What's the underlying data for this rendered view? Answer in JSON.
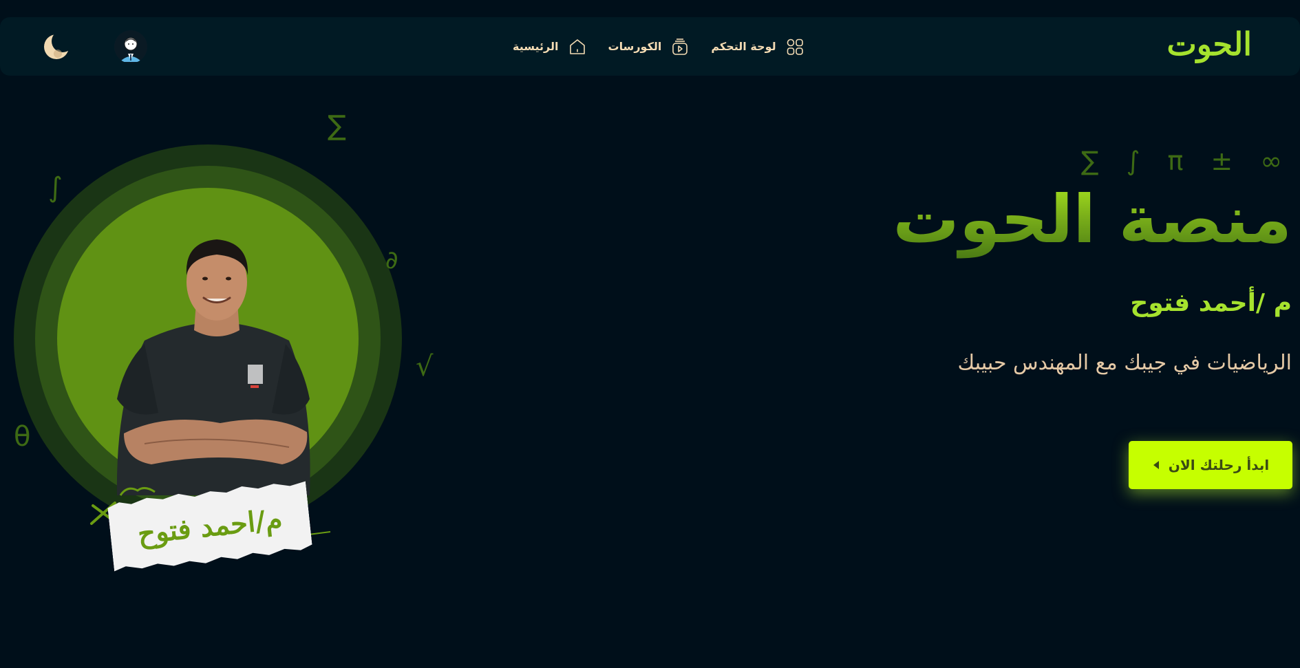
{
  "brand": {
    "logo_text": "الحوت"
  },
  "nav": {
    "items": [
      {
        "label": "الرئيسية",
        "icon": "home-icon"
      },
      {
        "label": "الكورسات",
        "icon": "video-stack-icon"
      },
      {
        "label": "لوحة التحكم",
        "icon": "dashboard-grid-icon"
      }
    ],
    "avatar_icon": "user-avatar-icon",
    "theme_icon": "moon-icon"
  },
  "hero": {
    "symbols": "∑ ∫ π ± ∞",
    "title": "منصة الحوت",
    "subtitle": "م /أحمد فتوح",
    "tagline": "الرياضيات في جيبك مع المهندس حبيبك",
    "cta_label": "ابدأ رحلتك الان",
    "cta_icon": "play-arrow-icon"
  },
  "portrait": {
    "name_card": "م/احمد فتوح",
    "floating_symbols": {
      "sigma": "∑",
      "integral": "∫",
      "partial": "∂",
      "root": "√",
      "theta": "θ"
    }
  },
  "colors": {
    "background": "#000f1a",
    "navbar": "#011a24",
    "accent": "#a6e22e",
    "cta": "#c6ff00",
    "nav_text": "#f5dcb4"
  }
}
